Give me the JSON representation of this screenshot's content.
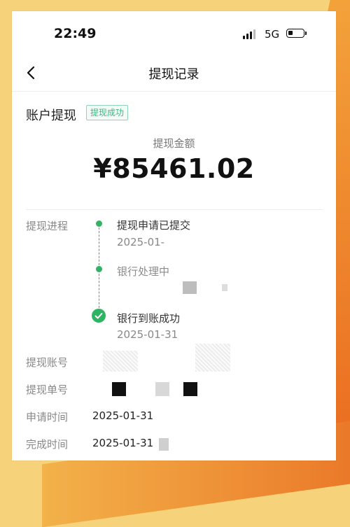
{
  "status_bar": {
    "time": "22:49",
    "network": "5G"
  },
  "nav": {
    "title": "提现记录"
  },
  "account": {
    "title": "账户提现",
    "badge": "提现成功"
  },
  "amount": {
    "label": "提现金额",
    "value": "¥85461.02"
  },
  "progress": {
    "label": "提现进程",
    "steps": [
      {
        "title": "提现申请已提交",
        "time": "2025-01-"
      },
      {
        "title": "银行处理中",
        "time": ""
      },
      {
        "title": "银行到账成功",
        "time": "2025-01-31"
      }
    ]
  },
  "details": {
    "account_label": "提现账号",
    "order_label": "提现单号",
    "apply_time_label": "申请时间",
    "apply_time_value": "2025-01-31",
    "complete_time_label": "完成时间",
    "complete_time_value": "2025-01-31"
  },
  "colors": {
    "accent_green": "#2fb463",
    "badge_green": "#3cb882"
  }
}
